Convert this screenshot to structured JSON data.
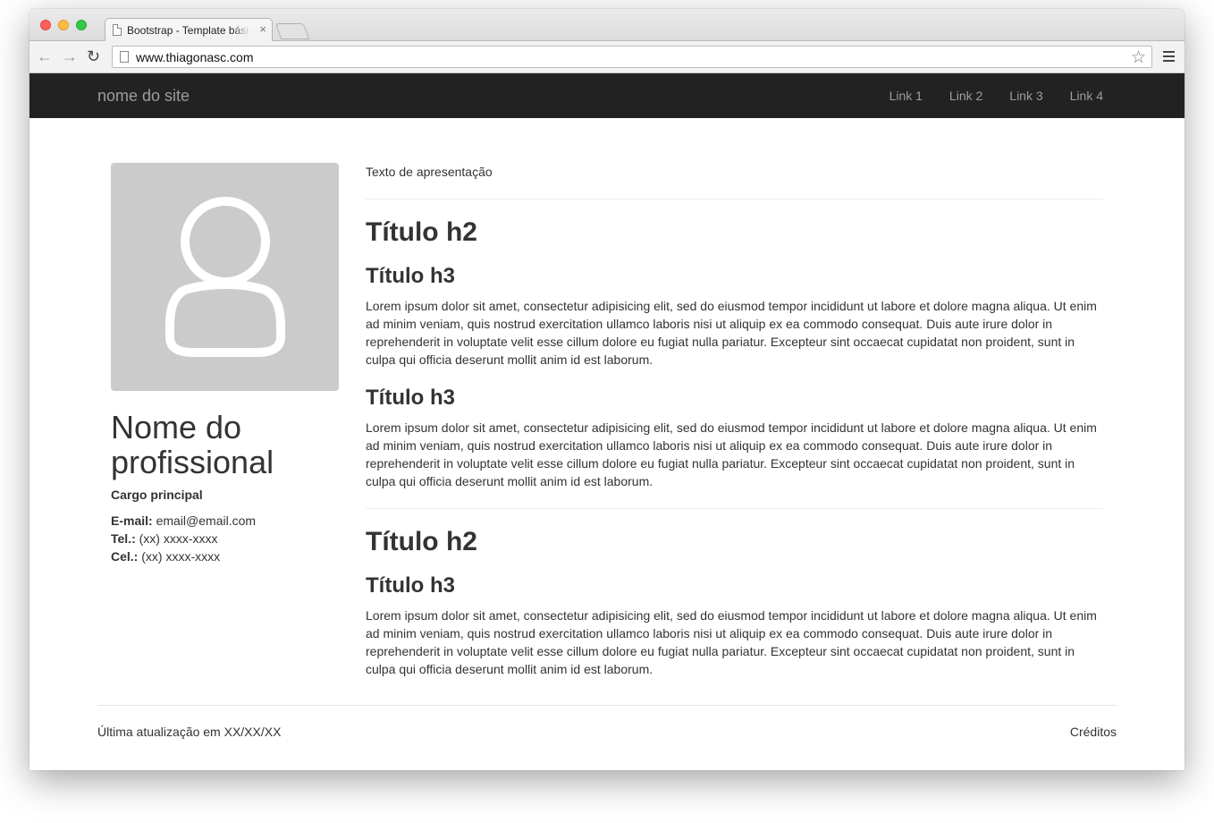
{
  "browser": {
    "tab_title": "Bootstrap - Template básico",
    "tab_close": "×",
    "url": "www.thiagonasc.com",
    "back_glyph": "←",
    "forward_glyph": "→",
    "reload_glyph": "↻",
    "star_glyph": "☆"
  },
  "navbar": {
    "brand": "nome do site",
    "links": [
      "Link 1",
      "Link 2",
      "Link 3",
      "Link 4"
    ]
  },
  "profile": {
    "name": "Nome do profissional",
    "role": "Cargo principal",
    "email_label": "E-mail:",
    "email": "email@email.com",
    "tel_label": "Tel.:",
    "tel": "(xx) xxxx-xxxx",
    "cel_label": "Cel.:",
    "cel": "(xx) xxxx-xxxx"
  },
  "main": {
    "intro": "Texto de apresentação",
    "sections": [
      {
        "h2": "Título h2",
        "subsections": [
          {
            "h3": "Título h3",
            "text": "Lorem ipsum dolor sit amet, consectetur adipisicing elit, sed do eiusmod tempor incididunt ut labore et dolore magna aliqua. Ut enim ad minim veniam, quis nostrud exercitation ullamco laboris nisi ut aliquip ex ea commodo consequat. Duis aute irure dolor in reprehenderit in voluptate velit esse cillum dolore eu fugiat nulla pariatur. Excepteur sint occaecat cupidatat non proident, sunt in culpa qui officia deserunt mollit anim id est laborum."
          },
          {
            "h3": "Título h3",
            "text": "Lorem ipsum dolor sit amet, consectetur adipisicing elit, sed do eiusmod tempor incididunt ut labore et dolore magna aliqua. Ut enim ad minim veniam, quis nostrud exercitation ullamco laboris nisi ut aliquip ex ea commodo consequat. Duis aute irure dolor in reprehenderit in voluptate velit esse cillum dolore eu fugiat nulla pariatur. Excepteur sint occaecat cupidatat non proident, sunt in culpa qui officia deserunt mollit anim id est laborum."
          }
        ]
      },
      {
        "h2": "Título h2",
        "subsections": [
          {
            "h3": "Título h3",
            "text": "Lorem ipsum dolor sit amet, consectetur adipisicing elit, sed do eiusmod tempor incididunt ut labore et dolore magna aliqua. Ut enim ad minim veniam, quis nostrud exercitation ullamco laboris nisi ut aliquip ex ea commodo consequat. Duis aute irure dolor in reprehenderit in voluptate velit esse cillum dolore eu fugiat nulla pariatur. Excepteur sint occaecat cupidatat non proident, sunt in culpa qui officia deserunt mollit anim id est laborum."
          }
        ]
      }
    ]
  },
  "footer": {
    "updated": "Última atualização em XX/XX/XX",
    "credits": "Créditos"
  },
  "colors": {
    "navbar_bg": "#222222",
    "navbar_text": "#9d9d9d",
    "avatar_bg": "#cbcbcb"
  }
}
